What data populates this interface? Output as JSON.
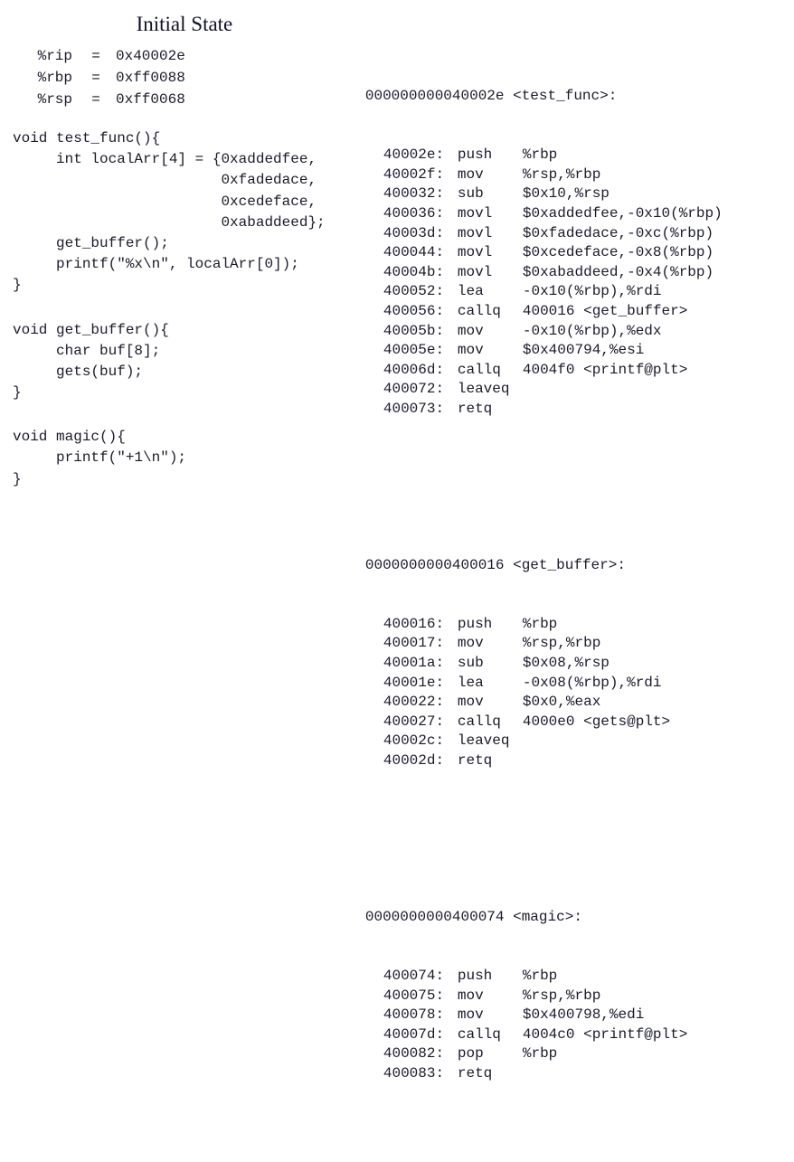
{
  "title": "Initial State",
  "registers": [
    {
      "name": "%rip",
      "value": "0x40002e"
    },
    {
      "name": "%rbp",
      "value": "0xff0088"
    },
    {
      "name": "%rsp",
      "value": "0xff0068"
    }
  ],
  "source": {
    "test_func": [
      "void test_func(){",
      "     int localArr[4] = {0xaddedfee,",
      "                        0xfadedace,",
      "                        0xcedeface,",
      "                        0xabaddeed};",
      "     get_buffer();",
      "     printf(\"%x\\n\", localArr[0]);",
      "}"
    ],
    "get_buffer": [
      "void get_buffer(){",
      "     char buf[8];",
      "     gets(buf);",
      "}"
    ],
    "magic": [
      "void magic(){",
      "     printf(\"+1\\n\");",
      "}"
    ]
  },
  "asm": {
    "test_func": {
      "header": "000000000040002e <test_func>:",
      "rows": [
        {
          "addr": "40002e:",
          "mnem": "push",
          "ops": "%rbp"
        },
        {
          "addr": "40002f:",
          "mnem": "mov",
          "ops": "%rsp,%rbp"
        },
        {
          "addr": "400032:",
          "mnem": "sub",
          "ops": "$0x10,%rsp"
        },
        {
          "addr": "400036:",
          "mnem": "movl",
          "ops": "$0xaddedfee,-0x10(%rbp)"
        },
        {
          "addr": "40003d:",
          "mnem": "movl",
          "ops": "$0xfadedace,-0xc(%rbp)"
        },
        {
          "addr": "400044:",
          "mnem": "movl",
          "ops": "$0xcedeface,-0x8(%rbp)"
        },
        {
          "addr": "40004b:",
          "mnem": "movl",
          "ops": "$0xabaddeed,-0x4(%rbp)"
        },
        {
          "addr": "400052:",
          "mnem": "lea",
          "ops": "-0x10(%rbp),%rdi"
        },
        {
          "addr": "400056:",
          "mnem": "callq",
          "ops": "400016 <get_buffer>"
        },
        {
          "addr": "40005b:",
          "mnem": "mov",
          "ops": "-0x10(%rbp),%edx"
        },
        {
          "addr": "40005e:",
          "mnem": "mov",
          "ops": "$0x400794,%esi"
        },
        {
          "addr": "40006d:",
          "mnem": "callq",
          "ops": "4004f0 <printf@plt>"
        },
        {
          "addr": "400072:",
          "mnem": "leaveq",
          "ops": ""
        },
        {
          "addr": "400073:",
          "mnem": "retq",
          "ops": ""
        }
      ]
    },
    "get_buffer": {
      "header": "0000000000400016 <get_buffer>:",
      "rows": [
        {
          "addr": "400016:",
          "mnem": "push",
          "ops": "%rbp"
        },
        {
          "addr": "400017:",
          "mnem": "mov",
          "ops": "%rsp,%rbp"
        },
        {
          "addr": "40001a:",
          "mnem": "sub",
          "ops": "$0x08,%rsp"
        },
        {
          "addr": "40001e:",
          "mnem": "lea",
          "ops": "-0x08(%rbp),%rdi"
        },
        {
          "addr": "400022:",
          "mnem": "mov",
          "ops": "$0x0,%eax"
        },
        {
          "addr": "400027:",
          "mnem": "callq",
          "ops": "4000e0 <gets@plt>"
        },
        {
          "addr": "40002c:",
          "mnem": "leaveq",
          "ops": ""
        },
        {
          "addr": "40002d:",
          "mnem": "retq",
          "ops": ""
        }
      ]
    },
    "magic": {
      "header": "0000000000400074 <magic>:",
      "rows": [
        {
          "addr": "400074:",
          "mnem": "push",
          "ops": "%rbp"
        },
        {
          "addr": "400075:",
          "mnem": "mov",
          "ops": "%rsp,%rbp"
        },
        {
          "addr": "400078:",
          "mnem": "mov",
          "ops": "$0x400798,%edi"
        },
        {
          "addr": "40007d:",
          "mnem": "callq",
          "ops": "4004c0 <printf@plt>"
        },
        {
          "addr": "400082:",
          "mnem": "pop",
          "ops": "%rbp"
        },
        {
          "addr": "400083:",
          "mnem": "retq",
          "ops": ""
        }
      ]
    }
  }
}
